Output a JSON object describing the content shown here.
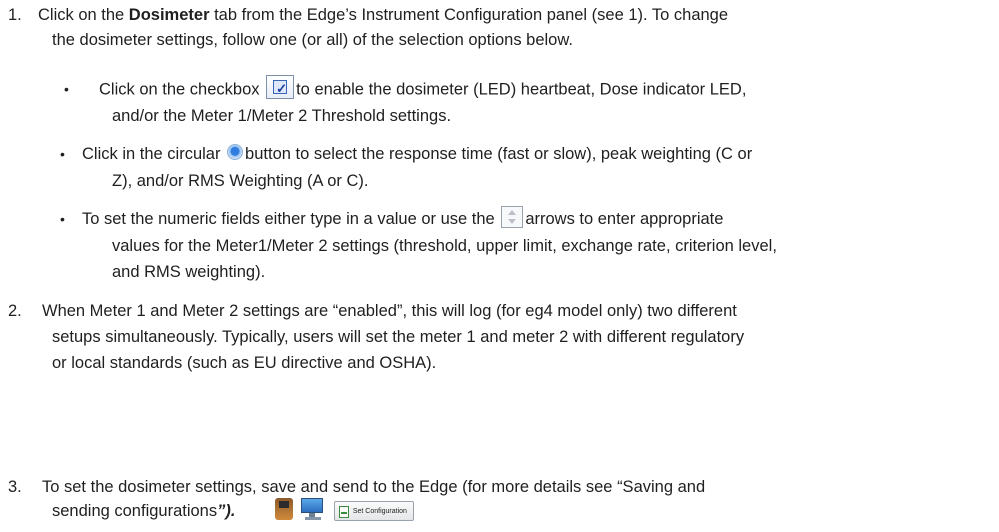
{
  "step1": {
    "number": "1.",
    "line1_pre": "Click on the ",
    "line1_bold": "Dosimeter",
    "line1_post": " tab from the Edge’s Instrument Configuration panel (see 1).  To change",
    "line2": "the dosimeter settings, follow one (or all) of the selection options below.",
    "bullets": [
      {
        "line1_pre": "Click on the checkbox ",
        "icon": "checkbox-checked-icon",
        "line1_post": "to enable the dosimeter (LED) heartbeat, Dose indicator LED,",
        "line2": "and/or the Meter 1/Meter 2 Threshold settings."
      },
      {
        "line1_pre": "Click in the circular ",
        "icon": "radio-button-icon",
        "line1_post": "button to select the response time (fast or slow), peak weighting (C or",
        "line2": "Z), and/or RMS Weighting (A or C)."
      },
      {
        "line1_pre": "To set the numeric fields either type in a value or use the ",
        "icon": "spinner-arrows-icon",
        "line1_post": "arrows to enter appropriate",
        "line2": "values for the Meter1/Meter 2 settings (threshold, upper limit, exchange rate, criterion level,",
        "line3": "and RMS weighting)."
      }
    ]
  },
  "step2": {
    "number": "2.",
    "line1": "When Meter 1 and Meter 2 settings are “enabled”, this will log (for eg4 model only) two different",
    "line2": "setups simultaneously.  Typically, users will set the meter 1 and meter 2 with different regulatory",
    "line3": "or local standards (such as EU directive and OSHA)."
  },
  "step3": {
    "number": "3.",
    "line1": "To set the dosimeter settings, save and send to the Edge (for more details see “Saving and",
    "line2_pre": "sending configurations",
    "line2_bold": "”).",
    "icons": [
      "dosimeter-device-icon",
      "computer-icon"
    ],
    "set_config_label": "Set Configuration"
  },
  "bullet_glyph": "•"
}
